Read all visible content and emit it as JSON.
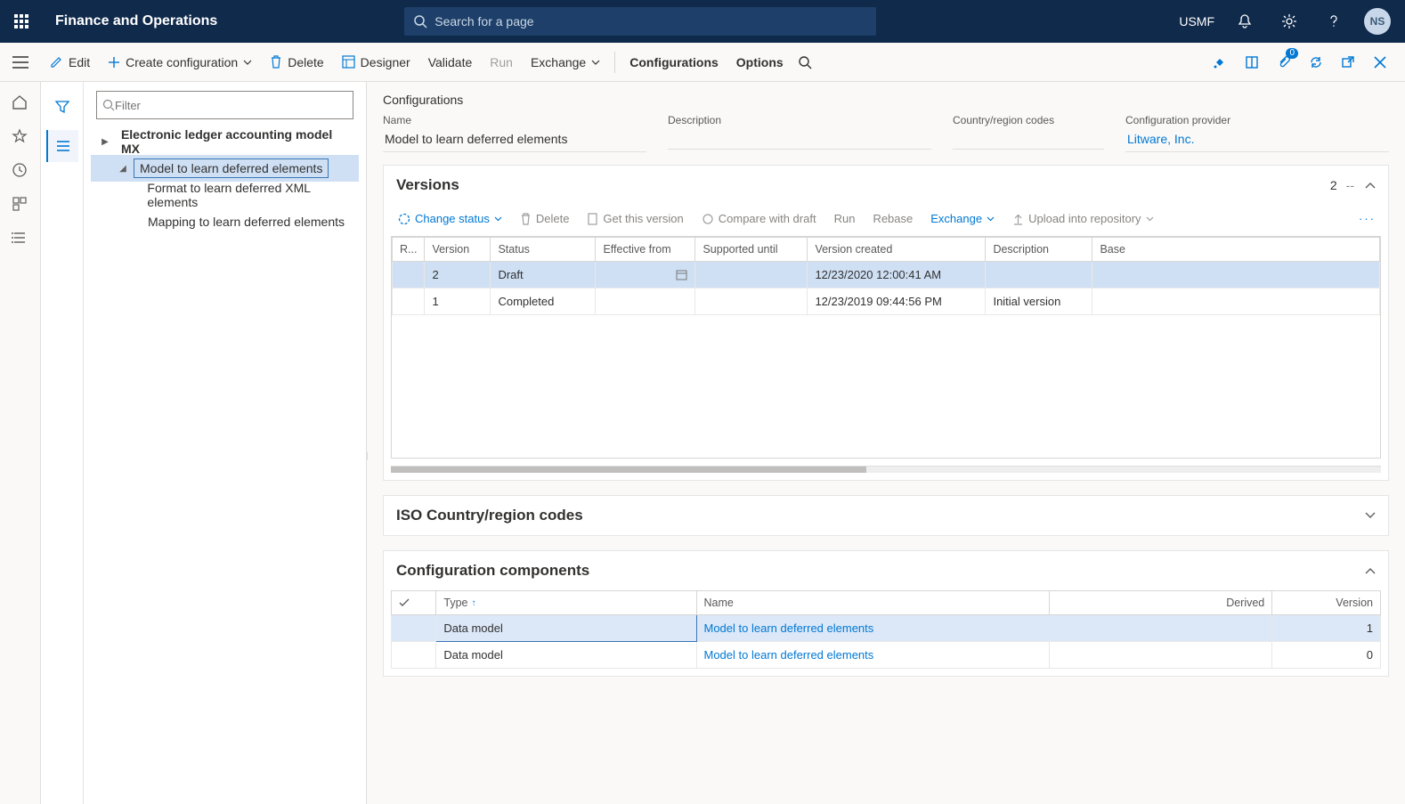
{
  "topbar": {
    "brand": "Finance and Operations",
    "search_placeholder": "Search for a page",
    "company": "USMF",
    "avatar_initials": "NS"
  },
  "cmdbar": {
    "edit": "Edit",
    "create": "Create configuration",
    "delete": "Delete",
    "designer": "Designer",
    "validate": "Validate",
    "run": "Run",
    "exchange": "Exchange",
    "configurations": "Configurations",
    "options": "Options",
    "attach_badge": "0"
  },
  "navpane": {
    "filter_placeholder": "Filter",
    "items": [
      {
        "label": "Electronic ledger accounting model MX",
        "level": 1,
        "expand": "right",
        "bold": true,
        "selected": false
      },
      {
        "label": "Model to learn deferred elements",
        "level": 2,
        "expand": "down",
        "bold": false,
        "selected": true
      },
      {
        "label": "Format to learn deferred XML elements",
        "level": 3,
        "expand": "",
        "bold": false,
        "selected": false
      },
      {
        "label": "Mapping to learn deferred elements",
        "level": 3,
        "expand": "",
        "bold": false,
        "selected": false
      }
    ]
  },
  "config": {
    "title": "Configurations",
    "name_label": "Name",
    "name_value": "Model to learn deferred elements",
    "desc_label": "Description",
    "desc_value": "",
    "country_label": "Country/region codes",
    "country_value": "",
    "provider_label": "Configuration provider",
    "provider_value": "Litware, Inc."
  },
  "versions": {
    "title": "Versions",
    "count": "2",
    "toolbar": {
      "change_status": "Change status",
      "delete": "Delete",
      "get_version": "Get this version",
      "compare": "Compare with draft",
      "run": "Run",
      "rebase": "Rebase",
      "exchange": "Exchange",
      "upload": "Upload into repository"
    },
    "headers": {
      "r": "R...",
      "version": "Version",
      "status": "Status",
      "effective": "Effective from",
      "supported": "Supported until",
      "created": "Version created",
      "desc": "Description",
      "base": "Base"
    },
    "rows": [
      {
        "r": "",
        "version": "2",
        "status": "Draft",
        "effective": "",
        "supported": "",
        "created": "12/23/2020 12:00:41 AM",
        "desc": "",
        "base": "",
        "selected": true
      },
      {
        "r": "",
        "version": "1",
        "status": "Completed",
        "effective": "",
        "supported": "",
        "created": "12/23/2019 09:44:56 PM",
        "desc": "Initial version",
        "base": "",
        "selected": false
      }
    ]
  },
  "iso_panel": {
    "title": "ISO Country/region codes"
  },
  "components": {
    "title": "Configuration components",
    "headers": {
      "type": "Type",
      "name": "Name",
      "derived": "Derived",
      "version": "Version"
    },
    "rows": [
      {
        "type": "Data model",
        "name": "Model to learn deferred elements",
        "derived": "",
        "version": "1",
        "selected": true
      },
      {
        "type": "Data model",
        "name": "Model to learn deferred elements",
        "derived": "",
        "version": "0",
        "selected": false
      }
    ]
  }
}
